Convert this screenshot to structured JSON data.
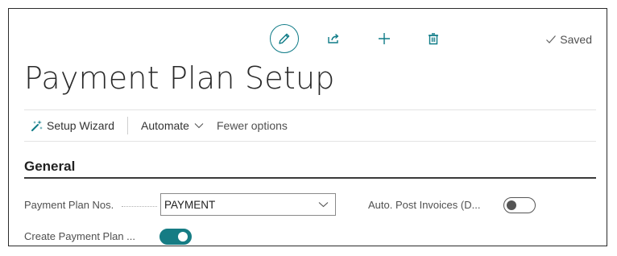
{
  "status": {
    "saved_label": "Saved"
  },
  "page": {
    "title": "Payment Plan Setup"
  },
  "toolbar": {
    "setup_wizard_label": "Setup Wizard",
    "automate_label": "Automate",
    "fewer_options_label": "Fewer options"
  },
  "section": {
    "title": "General"
  },
  "fields": {
    "payment_plan_nos": {
      "label": "Payment Plan Nos.",
      "value": "PAYMENT"
    },
    "auto_post_invoices": {
      "label": "Auto. Post Invoices (D...",
      "value": false
    },
    "create_payment_plan": {
      "label": "Create Payment Plan ...",
      "value": true
    }
  },
  "colors": {
    "accent": "#167c84",
    "text": "#212121",
    "muted": "#505050"
  },
  "icons": {
    "edit": "pencil-icon",
    "share": "share-icon",
    "add": "plus-icon",
    "delete": "trash-icon",
    "saved": "checkmark-icon",
    "wizard": "wizard-icon",
    "automate_chevron": "chevron-down-icon",
    "select_chevron": "chevron-down-icon"
  }
}
